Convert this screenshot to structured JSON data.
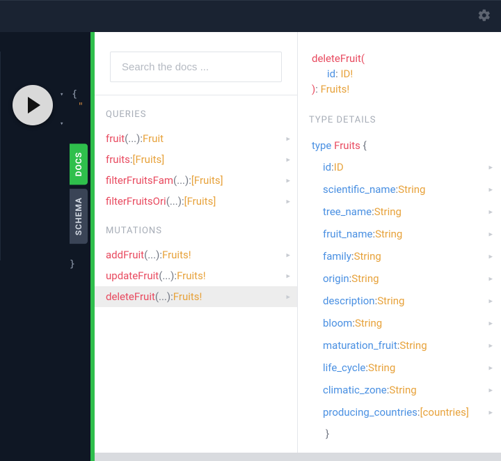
{
  "search": {
    "placeholder": "Search the docs ..."
  },
  "tabs": {
    "docs": "DOCS",
    "schema": "SCHEMA"
  },
  "sections": {
    "queries": "QUERIES",
    "mutations": "MUTATIONS",
    "type_details": "TYPE DETAILS"
  },
  "queries": [
    {
      "name": "fruit",
      "args": "(...)",
      "ret": "Fruit"
    },
    {
      "name": "fruits",
      "args": "",
      "ret": "[Fruits]"
    },
    {
      "name": "filterFruitsFam",
      "args": "(...)",
      "ret": "[Fruits]"
    },
    {
      "name": "filterFruitsOri",
      "args": "(...)",
      "ret": "[Fruits]"
    }
  ],
  "mutations": [
    {
      "name": "addFruit",
      "args": "(...)",
      "ret": "Fruits!"
    },
    {
      "name": "updateFruit",
      "args": "(...)",
      "ret": "Fruits!"
    },
    {
      "name": "deleteFruit",
      "args": "(...)",
      "ret": "Fruits!",
      "selected": true
    }
  ],
  "signature": {
    "name": "deleteFruit",
    "open": "(",
    "arg_name": "id",
    "arg_type": "ID!",
    "close": ")",
    "ret": "Fruits!"
  },
  "type_def": {
    "keyword": "type",
    "name": "Fruits",
    "open": "{",
    "close": "}",
    "fields": [
      {
        "name": "id",
        "type": "ID"
      },
      {
        "name": "scientific_name",
        "type": "String"
      },
      {
        "name": "tree_name",
        "type": "String"
      },
      {
        "name": "fruit_name",
        "type": "String"
      },
      {
        "name": "family",
        "type": "String"
      },
      {
        "name": "origin",
        "type": "String"
      },
      {
        "name": "description",
        "type": "String"
      },
      {
        "name": "bloom",
        "type": "String"
      },
      {
        "name": "maturation_fruit",
        "type": "String"
      },
      {
        "name": "life_cycle",
        "type": "String"
      },
      {
        "name": "climatic_zone",
        "type": "String"
      },
      {
        "name": "producing_countries",
        "type": "[countries]"
      }
    ]
  },
  "editor": {
    "brace_open": "{",
    "brace_close": "}",
    "quote": "\""
  },
  "glyphs": {
    "triangle": "▾",
    "chevron": "▸",
    "colon_space": ": "
  }
}
